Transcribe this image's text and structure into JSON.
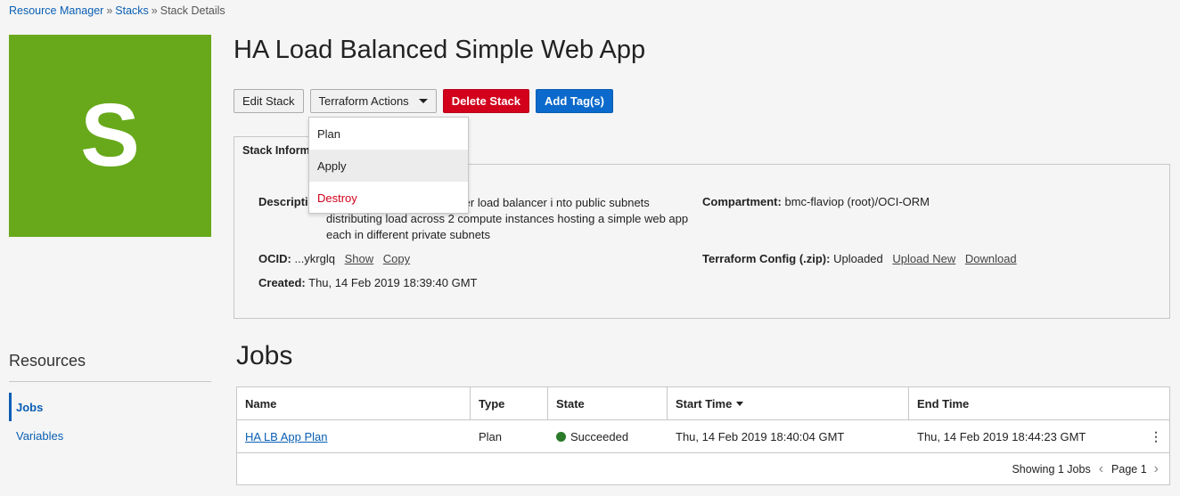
{
  "breadcrumb": {
    "items": [
      "Resource Manager",
      "Stacks",
      "Stack Details"
    ],
    "separator": "»"
  },
  "avatar": {
    "letter": "S",
    "color": "#67a91b"
  },
  "page": {
    "title": "HA Load Balanced Simple Web App"
  },
  "toolbar": {
    "edit_label": "Edit Stack",
    "terraform_label": "Terraform Actions",
    "delete_label": "Delete Stack",
    "tags_label": "Add Tag(s)"
  },
  "dropdown": {
    "items": [
      "Plan",
      "Apply",
      "Destroy"
    ]
  },
  "stack_info": {
    "tab_label": "Stack Inform",
    "description_label": "Descriptio",
    "description_value": "l load balancer and a failover load balancer i nto public subnets distributing load across 2 compute instances hosting a simple web app each in different private subnets",
    "ocid_label": "OCID:",
    "ocid_value": "...ykrglq",
    "show_label": "Show",
    "copy_label": "Copy",
    "created_label": "Created:",
    "created_value": "Thu, 14 Feb 2019 18:39:40 GMT",
    "compartment_label": "Compartment:",
    "compartment_value": "bmc-flaviop (root)/OCI-ORM",
    "tfconfig_label": "Terraform Config (.zip):",
    "tfconfig_value": "Uploaded",
    "upload_new_label": "Upload New",
    "download_label": "Download"
  },
  "resources": {
    "title": "Resources",
    "items": [
      "Jobs",
      "Variables"
    ]
  },
  "jobs": {
    "title": "Jobs",
    "columns": [
      "Name",
      "Type",
      "State",
      "Start Time",
      "End Time"
    ],
    "rows": [
      {
        "name": "HA LB App Plan",
        "type": "Plan",
        "state": "Succeeded",
        "start": "Thu, 14 Feb 2019 18:40:04 GMT",
        "end": "Thu, 14 Feb 2019 18:44:23 GMT"
      }
    ],
    "footer": {
      "count_label": "Showing 1 Jobs",
      "page_label": "Page 1"
    }
  },
  "colors": {
    "accent": "#0a5fb4",
    "danger": "#d3001c",
    "primary": "#0b6acb",
    "success": "#2a7a2a"
  }
}
